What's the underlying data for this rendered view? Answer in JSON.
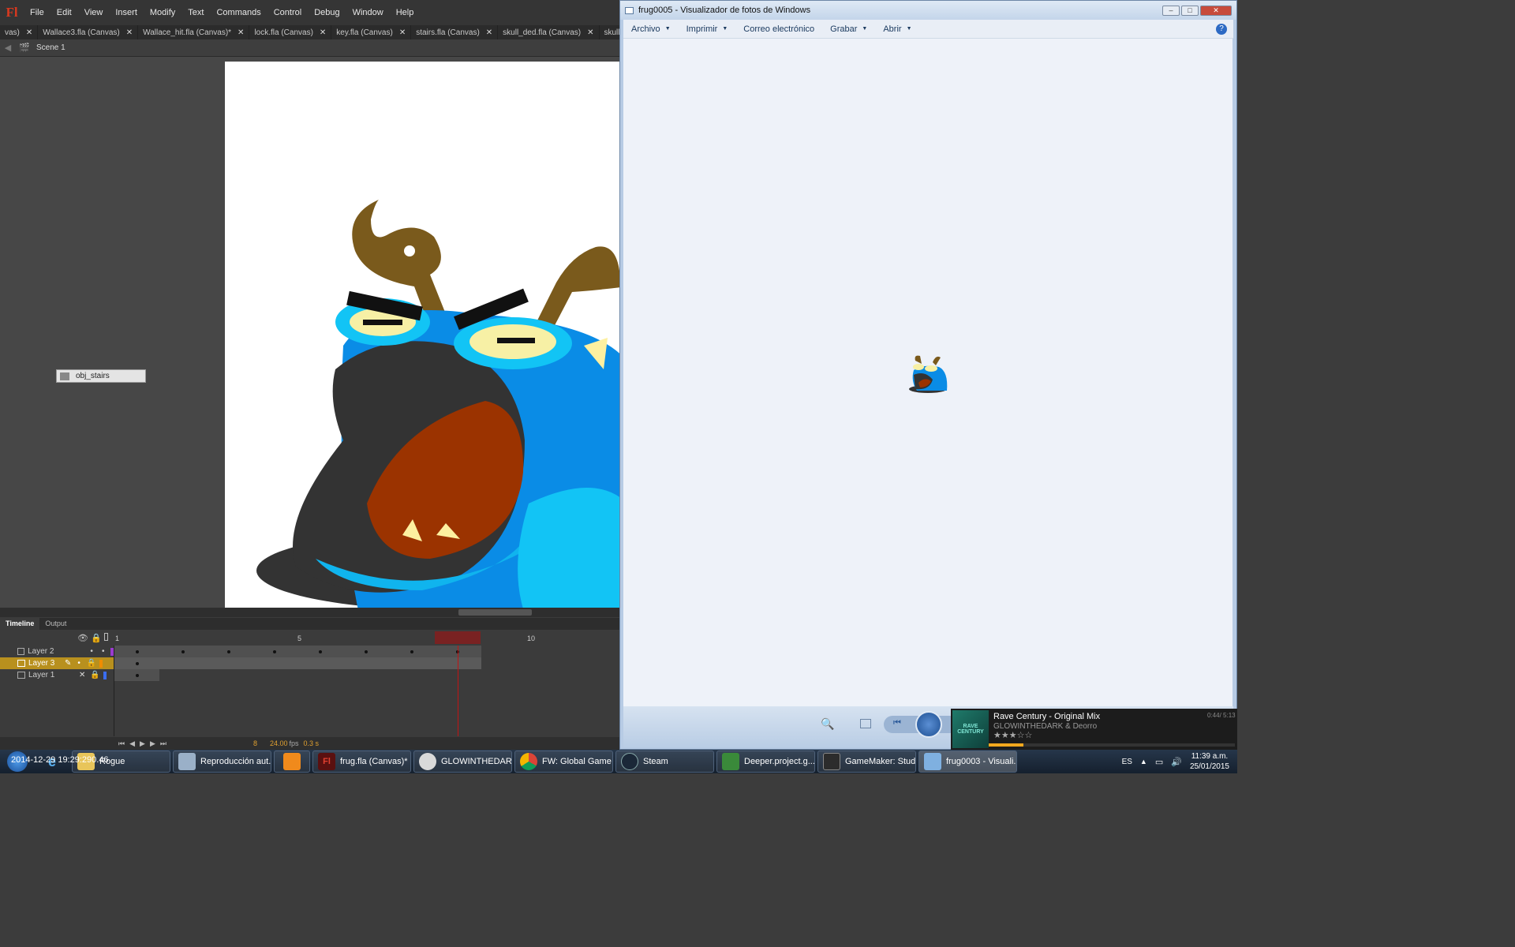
{
  "flash": {
    "logo": "Fl",
    "menu": [
      "File",
      "Edit",
      "View",
      "Insert",
      "Modify",
      "Text",
      "Commands",
      "Control",
      "Debug",
      "Window",
      "Help"
    ],
    "tabs": [
      "vas)",
      "Wallace3.fla (Canvas)",
      "Wallace_hit.fla (Canvas)*",
      "lock.fla (Canvas)",
      "key.fla (Canvas)",
      "stairs.fla (Canvas)",
      "skull_ded.fla (Canvas)",
      "skull.fla (Canvas"
    ],
    "scene": "Scene 1",
    "object_label": "obj_stairs",
    "timeline": {
      "tabs": [
        "Timeline",
        "Output"
      ],
      "frame_numbers": [
        "1",
        "5",
        "10"
      ],
      "layers": [
        {
          "name": "Layer 2",
          "color": "#9b3bcf"
        },
        {
          "name": "Layer 3",
          "color": "#f08c00"
        },
        {
          "name": "Layer 1",
          "color": "#3a6df0"
        }
      ],
      "current_frame": "8",
      "fps": "24.00",
      "fps_unit": "fps",
      "time": "0.3 s"
    }
  },
  "viewer": {
    "title": "frug0005 - Visualizador de fotos de Windows",
    "menu": [
      "Archivo",
      "Imprimir",
      "Correo electrónico",
      "Grabar",
      "Abrir"
    ],
    "help": "?"
  },
  "media": {
    "track": "Rave Century - Original Mix",
    "artist": "GLOWINTHEDARK & Deorro",
    "time": "0:44/ 5:13",
    "album_text": "RAVE CENTURY"
  },
  "taskbar": {
    "overlay_text": "2014-12-29 19:29:290.46",
    "items": [
      {
        "label": "Rogue",
        "icon": "folder-icon"
      },
      {
        "label": "Reproducción aut...",
        "icon": "media-icon"
      },
      {
        "label": "",
        "icon": "vlc-icon"
      },
      {
        "label": "frug.fla (Canvas)*",
        "icon": "flash-icon"
      },
      {
        "label": "GLOWINTHEDAR...",
        "icon": "music-icon"
      },
      {
        "label": "FW: Global Game ...",
        "icon": "chrome-icon"
      },
      {
        "label": "Steam",
        "icon": "steam-icon"
      },
      {
        "label": "Deeper.project.g...",
        "icon": "gamemaker-icon"
      },
      {
        "label": "GameMaker: Studio",
        "icon": "gamemaker-icon"
      },
      {
        "label": "frug0003 - Visuali...",
        "icon": "photo-icon"
      }
    ],
    "lang": "ES",
    "clock_time": "11:39 a.m.",
    "clock_date": "25/01/2015"
  }
}
